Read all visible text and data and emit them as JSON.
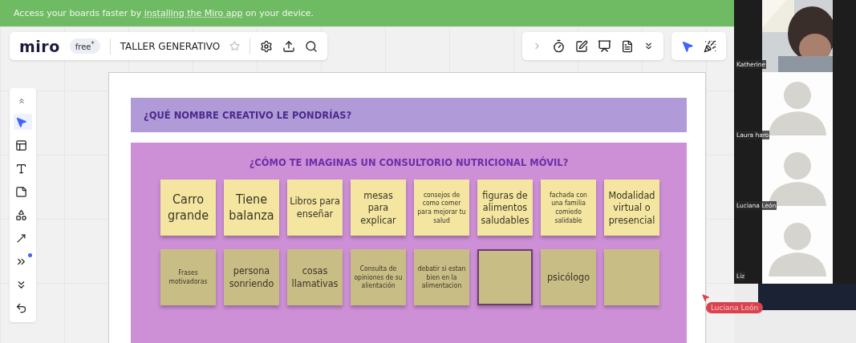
{
  "banner": {
    "before": "Access your boards faster by ",
    "link": "installing the Miro app",
    "after": " on your device."
  },
  "toolbar": {
    "logo": "miro",
    "plan": "free$^{*}$",
    "board_title": "TALLER GENERATIVO",
    "starred": false
  },
  "tools": [
    {
      "selected": false
    },
    {
      "selected": true
    },
    {
      "selected": false
    },
    {
      "selected": false
    },
    {
      "selected": false
    },
    {
      "selected": false
    },
    {
      "selected": false
    },
    {
      "selected": false
    },
    {
      "selected": false
    },
    {
      "selected": false
    }
  ],
  "frame": {
    "header": "¿QUÉ NOMBRE CREATIVO LE PONDRÍAS?",
    "section_title": "¿CÓMO TE IMAGINAS UN CONSULTORIO NUTRICIONAL MÓVIL?",
    "rows": [
      [
        {
          "text": "Carro grande",
          "kind": "large",
          "selected": false
        },
        {
          "text": "Tiene balanza",
          "kind": "large",
          "selected": false
        },
        {
          "text": "Libros para enseñar",
          "kind": "medium",
          "selected": false
        },
        {
          "text": "mesas para explicar",
          "kind": "medium",
          "selected": false
        },
        {
          "text": "consejos de como comer para mejorar tu salud",
          "kind": "small",
          "selected": false
        },
        {
          "text": "figuras de alimentos saludables",
          "kind": "medium",
          "selected": false
        },
        {
          "text": "fachada con una familia comiedo salidable",
          "kind": "small",
          "selected": false
        },
        {
          "text": "Modalidad virtual o presencial",
          "kind": "medium",
          "selected": false
        }
      ],
      [
        {
          "text": "Frases motivadoras",
          "kind": "small",
          "selected": false
        },
        {
          "text": "persona sonriendo",
          "kind": "medium",
          "selected": false
        },
        {
          "text": "cosas llamativas",
          "kind": "medium",
          "selected": false
        },
        {
          "text": "Consulta de opiniones de su alientación",
          "kind": "small",
          "selected": false
        },
        {
          "text": "debatir si estan bien en la alimentacion",
          "kind": "small",
          "selected": false
        },
        {
          "text": "",
          "kind": "medium",
          "selected": true
        },
        {
          "text": "psicólogo",
          "kind": "medium",
          "selected": false
        },
        {
          "text": "",
          "kind": "medium",
          "selected": false
        }
      ]
    ]
  },
  "cursor": {
    "name": "Luciana León"
  },
  "participants": [
    {
      "name": "Katherine",
      "video": true
    },
    {
      "name": "Laura haro",
      "video": false
    },
    {
      "name": "Luciana León",
      "video": false
    },
    {
      "name": "Liz",
      "video": false
    }
  ]
}
